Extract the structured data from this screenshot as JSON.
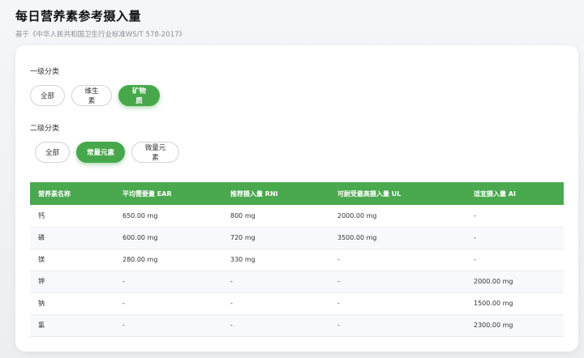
{
  "header": {
    "title": "每日营养素参考摄入量",
    "subtitle": "基于《中华人民共和国卫生行业标准WS/T 578-2017》"
  },
  "filters": {
    "level1_label": "一级分类",
    "level1_options": [
      "全部",
      "维生素",
      "矿物质"
    ],
    "level1_selected": "矿物质",
    "level2_label": "二级分类",
    "level2_options": [
      "全部",
      "常量元素",
      "微量元素"
    ],
    "level2_selected": "常量元素"
  },
  "table": {
    "columns": [
      "营养素名称",
      "平均需要量 EAR",
      "推荐摄入量 RNI",
      "可耐受最高摄入量 UL",
      "适宜摄入量 AI"
    ],
    "rows": [
      [
        "钙",
        "650.00 mg",
        "800 mg",
        "2000.00 mg",
        "-"
      ],
      [
        "磷",
        "600.00 mg",
        "720 mg",
        "3500.00 mg",
        "-"
      ],
      [
        "镁",
        "280.00 mg",
        "330 mg",
        "-",
        "-"
      ],
      [
        "钾",
        "-",
        "-",
        "-",
        "2000.00 mg"
      ],
      [
        "钠",
        "-",
        "-",
        "-",
        "1500.00 mg"
      ],
      [
        "氯",
        "-",
        "-",
        "-",
        "2300.00 mg"
      ]
    ]
  },
  "colors": {
    "accent": "#47a84b",
    "header_bg": "#4aa84e"
  }
}
